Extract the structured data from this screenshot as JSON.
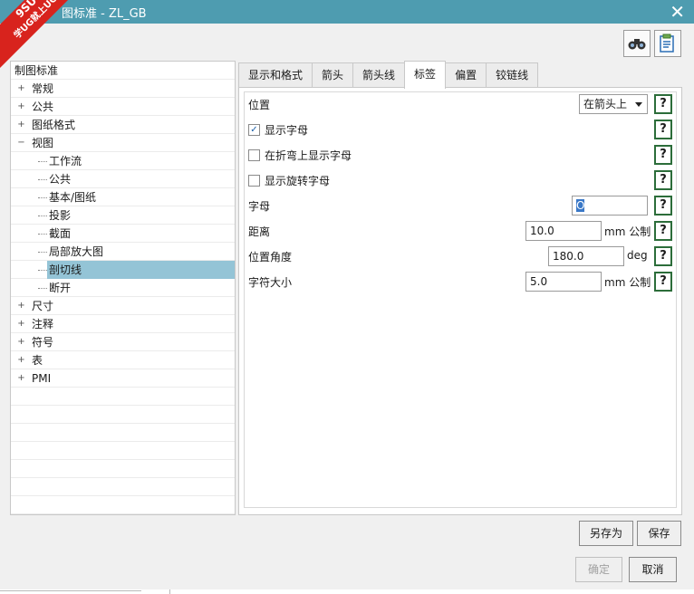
{
  "window": {
    "title": "图标准 - ZL_GB",
    "close_symbol": "✕"
  },
  "watermark": {
    "line1": "9SUG",
    "line2": "学UG就上UG网"
  },
  "toolbar": {
    "icons": [
      "binoculars-icon",
      "document-list-icon"
    ]
  },
  "tree": {
    "root": "制图标准",
    "items": [
      {
        "label": "常规",
        "level": 1,
        "expander": "+"
      },
      {
        "label": "公共",
        "level": 1,
        "expander": "+"
      },
      {
        "label": "图纸格式",
        "level": 1,
        "expander": "+"
      },
      {
        "label": "视图",
        "level": 1,
        "expander": "−"
      },
      {
        "label": "工作流",
        "level": 2
      },
      {
        "label": "公共",
        "level": 2
      },
      {
        "label": "基本/图纸",
        "level": 2
      },
      {
        "label": "投影",
        "level": 2
      },
      {
        "label": "截面",
        "level": 2
      },
      {
        "label": "局部放大图",
        "level": 2
      },
      {
        "label": "剖切线",
        "level": 2,
        "selected": true
      },
      {
        "label": "断开",
        "level": 2
      },
      {
        "label": "尺寸",
        "level": 1,
        "expander": "+"
      },
      {
        "label": "注释",
        "level": 1,
        "expander": "+"
      },
      {
        "label": "符号",
        "level": 1,
        "expander": "+"
      },
      {
        "label": "表",
        "level": 1,
        "expander": "+"
      },
      {
        "label": "PMI",
        "level": 1,
        "expander": "+"
      }
    ]
  },
  "tabs": [
    {
      "label": "显示和格式",
      "active": false
    },
    {
      "label": "箭头",
      "active": false
    },
    {
      "label": "箭头线",
      "active": false
    },
    {
      "label": "标签",
      "active": true
    },
    {
      "label": "偏置",
      "active": false
    },
    {
      "label": "铰链线",
      "active": false
    }
  ],
  "form": {
    "help_symbol": "?",
    "position": {
      "label": "位置",
      "value": "在箭头上"
    },
    "show_letter": {
      "label": "显示字母",
      "checked": true
    },
    "show_on_bend": {
      "label": "在折弯上显示字母",
      "checked": false
    },
    "show_rotate": {
      "label": "显示旋转字母",
      "checked": false
    },
    "letter": {
      "label": "字母",
      "value": "O"
    },
    "distance": {
      "label": "距离",
      "value": "10.0",
      "unit": "mm 公制"
    },
    "angle": {
      "label": "位置角度",
      "value": "180.0",
      "unit": "deg"
    },
    "char_size": {
      "label": "字符大小",
      "value": "5.0",
      "unit": "mm 公制"
    }
  },
  "buttons": {
    "save_as": "另存为",
    "save": "保存",
    "ok": "确定",
    "cancel": "取消"
  }
}
